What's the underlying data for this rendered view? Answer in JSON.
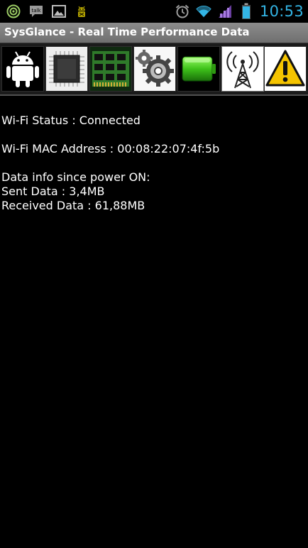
{
  "status_bar": {
    "notification_icons": [
      "wifi-notification-icon",
      "talk-icon",
      "gallery-icon",
      "android-debug-icon"
    ],
    "talk_label": "talk",
    "status_icons": [
      "alarm-icon",
      "wifi-signal-icon",
      "cell-signal-icon",
      "battery-icon"
    ],
    "clock": "10:53",
    "accent_color": "#33b5e5"
  },
  "app": {
    "title": "SysGlance - Real Time Performance Data"
  },
  "toolbar": {
    "tabs": [
      {
        "icon": "android-icon"
      },
      {
        "icon": "cpu-chip-icon"
      },
      {
        "icon": "memory-module-icon"
      },
      {
        "icon": "gears-icon"
      },
      {
        "icon": "battery-icon"
      },
      {
        "icon": "antenna-tower-icon",
        "selected": true
      },
      {
        "icon": "warning-icon"
      }
    ]
  },
  "content": {
    "wifi_status": "Wi-Fi Status : Connected",
    "wifi_mac": "Wi-Fi MAC Address : 00:08:22:07:4f:5b",
    "data_header": "Data info since power ON:",
    "sent_data": "Sent Data : 3,4MB",
    "received_data": "Received Data : 61,88MB"
  }
}
